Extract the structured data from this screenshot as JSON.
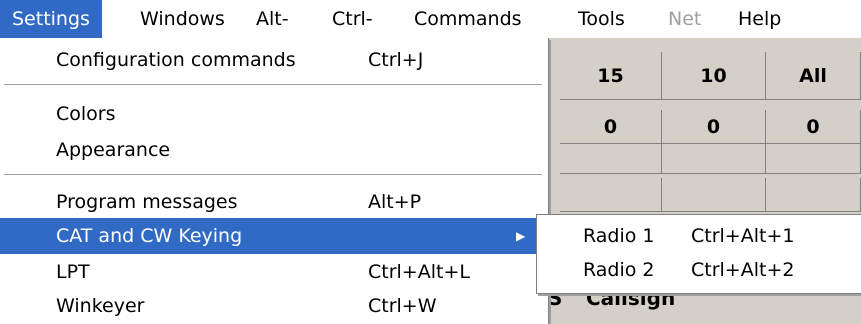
{
  "menubar": {
    "items": [
      {
        "label": "Settings"
      },
      {
        "label": "Windows"
      },
      {
        "label": "Alt-"
      },
      {
        "label": "Ctrl-"
      },
      {
        "label": "Commands"
      },
      {
        "label": "Tools"
      },
      {
        "label": "Net"
      },
      {
        "label": "Help"
      }
    ]
  },
  "settings_menu": {
    "items": [
      {
        "label": "Configuration commands",
        "shortcut": "Ctrl+J"
      },
      {
        "label": "Colors",
        "shortcut": ""
      },
      {
        "label": "Appearance",
        "shortcut": ""
      },
      {
        "label": "Program messages",
        "shortcut": "Alt+P"
      },
      {
        "label": "CAT and CW Keying",
        "shortcut": ""
      },
      {
        "label": "LPT",
        "shortcut": "Ctrl+Alt+L"
      },
      {
        "label": "Winkeyer",
        "shortcut": "Ctrl+W"
      }
    ]
  },
  "submenu": {
    "items": [
      {
        "label": "Radio 1",
        "shortcut": "Ctrl+Alt+1"
      },
      {
        "label": "Radio 2",
        "shortcut": "Ctrl+Alt+2"
      }
    ]
  },
  "grid": {
    "headers": [
      "15",
      "10",
      "All"
    ],
    "values": [
      "0",
      "0",
      "0"
    ],
    "callsign_prefix": "S",
    "callsign_label": "Callsign"
  }
}
